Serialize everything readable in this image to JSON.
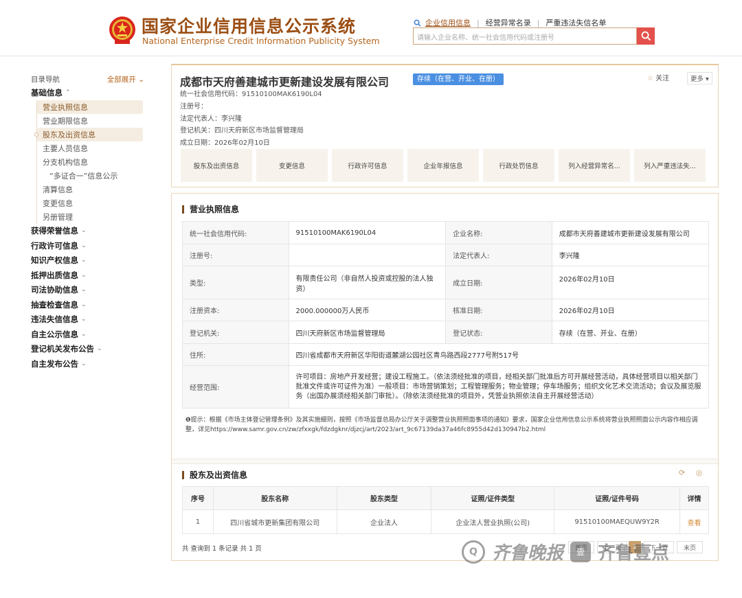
{
  "header": {
    "title_cn": "国家企业信用信息公示系统",
    "title_en": "National Enterprise Credit Information Publicity System",
    "nav": [
      "企业信用信息",
      "经营异常名录",
      "严重违法失信名单"
    ],
    "search_placeholder": "请输入企业名称、统一社会信用代码或注册号"
  },
  "sidebar": {
    "nav_title": "目录导航",
    "expand_all": "全部展开",
    "group_basic": "基础信息",
    "basic_items": [
      "营业执照信息",
      "营业期限信息",
      "股东及出资信息",
      "主要人员信息",
      "分支机构信息",
      "“多证合一”信息公示",
      "清算信息",
      "变更信息",
      "另册管理"
    ],
    "groups": [
      "获得荣誉信息",
      "行政许可信息",
      "知识产权信息",
      "抵押出质信息",
      "司法协助信息",
      "抽查检查信息",
      "违法失信信息",
      "自主公示信息",
      "登记机关发布公告",
      "自主发布公告"
    ]
  },
  "company": {
    "name": "成都市天府善建城市更新建设发展有限公司",
    "status": "存续（在营、开业、在册）",
    "follow": "关注",
    "more": "更多",
    "credit_code": "统一社会信用代码：91510100MAK6190L04",
    "reg_no": "注册号：",
    "legal_rep": "法定代表人：李兴隆",
    "reg_authority": "登记机关：四川天府新区市场监督管理局",
    "est_date": "成立日期：2026年02月10日",
    "tabs": [
      "股东及出资信息",
      "变更信息",
      "行政许可信息",
      "企业年报信息",
      "行政处罚信息",
      "列入经营异常名...",
      "列入严重违法失..."
    ]
  },
  "license": {
    "title": "营业执照信息",
    "rows": [
      {
        "k1": "统一社会信用代码:",
        "v1": "91510100MAK6190L04",
        "k2": "企业名称:",
        "v2": "成都市天府善建城市更新建设发展有限公司"
      },
      {
        "k1": "注册号:",
        "v1": "",
        "k2": "法定代表人:",
        "v2": "李兴隆"
      },
      {
        "k1": "类型:",
        "v1": "有限责任公司（非自然人投资或控股的法人独资）",
        "k2": "成立日期:",
        "v2": "2026年02月10日"
      },
      {
        "k1": "注册资本:",
        "v1": "2000.000000万人民币",
        "k2": "核准日期:",
        "v2": "2026年02月10日"
      },
      {
        "k1": "登记机关:",
        "v1": "四川天府新区市场监督管理局",
        "k2": "登记状态:",
        "v2": "存续（在营、开业、在册）"
      }
    ],
    "address_label": "住所:",
    "address": "四川省成都市天府新区华阳街道麓湖公园社区青鸟路西段2777号附517号",
    "scope_label": "经营范围:",
    "scope": "许可项目：房地产开发经营；建设工程施工。（依法须经批准的项目，经相关部门批准后方可开展经营活动，具体经营项目以相关部门批准文件或许可证件为准）一般项目：市场营销策划；工程管理服务；物业管理；停车场服务；组织文化艺术交流活动；会议及展览服务（出国办展须经相关部门审批）。（除依法须经批准的项目外，凭营业执照依法自主开展经营活动）",
    "tip": "提示：根据《市场主体登记管理条例》及其实施细则，按照《市场监督总局办公厅关于调整营业执照照面事项的通知》要求，国家企业信用信息公示系统将营业执照照面公示内容作相应调整，详见https://www.samr.gov.cn/zw/zfxxgk/fdzdgknr/djzcj/art/2023/art_9c67139da37a46fc8955d42d130947b2.html"
  },
  "shareholders": {
    "title": "股东及出资信息",
    "columns": [
      "序号",
      "股东名称",
      "股东类型",
      "证照/证件类型",
      "证照/证件号码",
      "详情"
    ],
    "rows": [
      {
        "no": "1",
        "name": "四川省城市更新集团有限公司",
        "type": "企业法人",
        "cert_type": "企业法人营业执照(公司)",
        "cert_no": "91510100MAEQUW9Y2R",
        "detail": "查看"
      }
    ],
    "total": "共 查询到 1 条记录 共 1 页",
    "pager": [
      "首页",
      "上一页",
      "1",
      "下一页",
      "末页"
    ]
  },
  "watermark": {
    "left": "齐鲁晚报",
    "right": "齐鲁壹点",
    "badge": "壹"
  }
}
